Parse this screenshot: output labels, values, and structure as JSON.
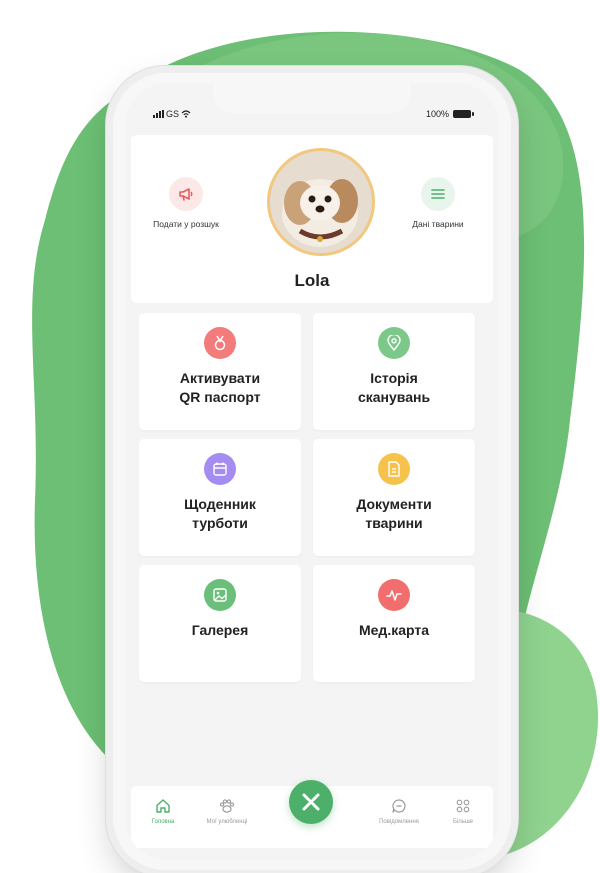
{
  "colors": {
    "brand_green": "#4caf6a",
    "blob_green": "#6cbf74",
    "blob_green_light": "#8fd38f",
    "red": "#f27b7b",
    "green": "#7cc88a",
    "purple": "#a48cf0",
    "yellow": "#f7c24c",
    "gallery_green": "#6cbf7a",
    "coral": "#f26d6d"
  },
  "status_bar": {
    "carrier": "GS",
    "battery": "100%"
  },
  "profile": {
    "pet_name": "Lola",
    "left_action": {
      "label": "Подати у розшук",
      "icon": "megaphone-icon"
    },
    "right_action": {
      "label": "Дані тварини",
      "icon": "list-icon"
    }
  },
  "tiles": [
    {
      "label": "Активувати\nQR паспорт",
      "icon": "medal-icon"
    },
    {
      "label": "Історія\nсканувань",
      "icon": "location-pin-icon"
    },
    {
      "label": "Щоденник\nтурботи",
      "icon": "calendar-icon"
    },
    {
      "label": "Документи\nтварини",
      "icon": "document-icon"
    },
    {
      "label": "Галерея",
      "icon": "image-icon"
    },
    {
      "label": "Мед.карта",
      "icon": "pulse-icon"
    }
  ],
  "tabbar": {
    "items": [
      {
        "label": "Головна",
        "icon": "home-icon",
        "active": true
      },
      {
        "label": "Мої улюбленці",
        "icon": "paw-icon",
        "active": false
      },
      {
        "label": "",
        "icon": "qr-scan-icon",
        "active": false
      },
      {
        "label": "Повідомлення",
        "icon": "chat-icon",
        "active": false
      },
      {
        "label": "Більше",
        "icon": "grid-icon",
        "active": false
      }
    ]
  }
}
